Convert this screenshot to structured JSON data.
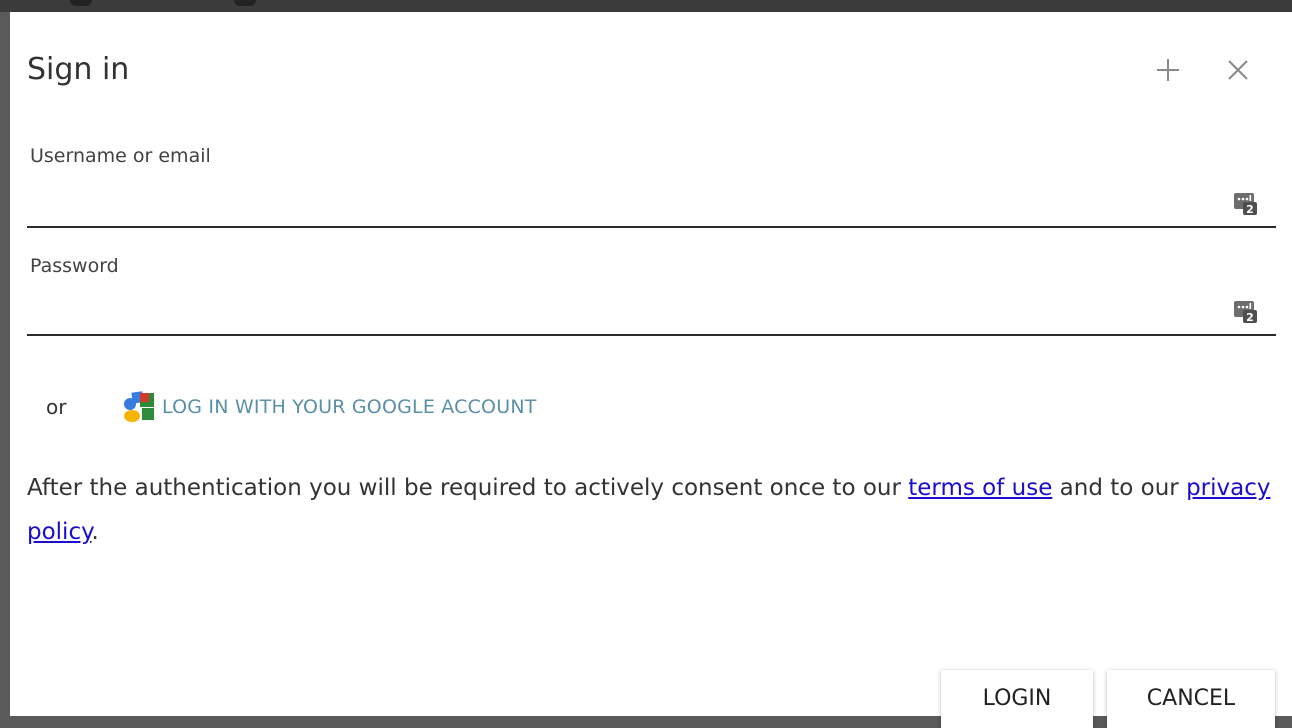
{
  "dialog": {
    "title": "Sign in",
    "add_button_icon": "plus-icon",
    "close_button_icon": "close-icon"
  },
  "username": {
    "label": "Username or email",
    "value": "",
    "placeholder": "",
    "icon": "password-manager-icon"
  },
  "password": {
    "label": "Password",
    "value": "",
    "placeholder": "",
    "icon": "password-manager-icon"
  },
  "alt_login": {
    "or_text": "or",
    "google_label": "LOG IN WITH YOUR GOOGLE ACCOUNT",
    "google_icon": "google-logo-icon"
  },
  "consent": {
    "text_before": "After the authentication you will be required to actively consent once to our ",
    "terms_link": "terms of use",
    "text_middle": " and to our ",
    "privacy_link": "privacy policy",
    "text_after": "."
  },
  "footer": {
    "login_label": "LOGIN",
    "cancel_label": "CANCEL"
  },
  "colors": {
    "link": "#1a0dcc",
    "google_text": "#5b8fa8",
    "underline": "#2b2b2b",
    "title": "#333333"
  }
}
